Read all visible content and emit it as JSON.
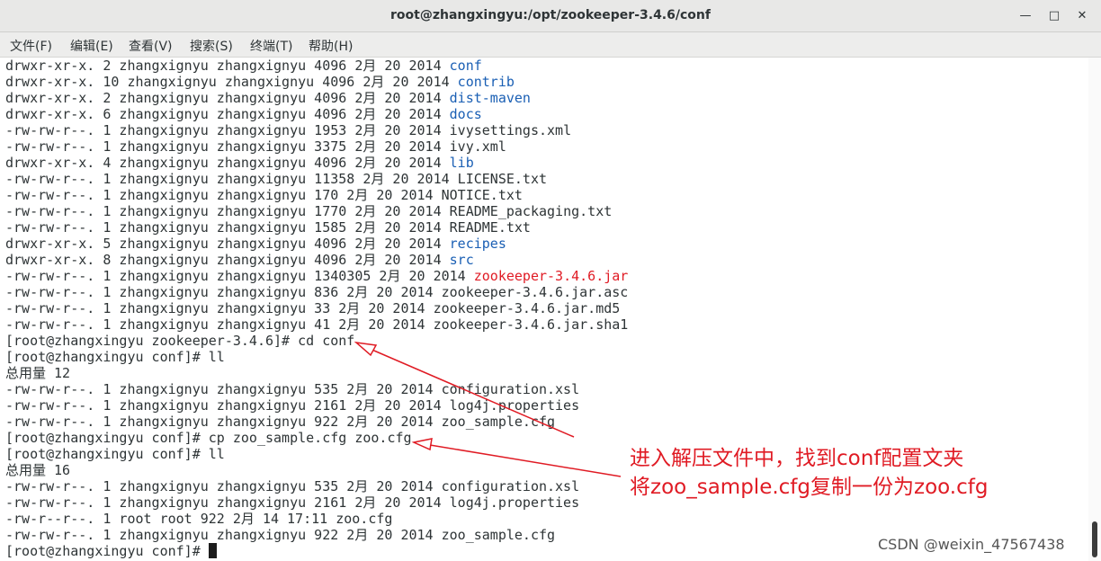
{
  "window": {
    "title": "root@zhangxingyu:/opt/zookeeper-3.4.6/conf",
    "minimize_icon": "minimize-icon",
    "maximize_icon": "maximize-icon",
    "close_icon": "close-icon"
  },
  "menu": [
    "文件(F)",
    "编辑(E)",
    "查看(V)",
    "搜索(S)",
    "终端(T)",
    "帮助(H)"
  ],
  "terminal": {
    "lines": [
      {
        "text": "drwxr-xr-x. 2 zhangxignyu zhangxignyu 4096 2月 20 2014 ",
        "name": "conf",
        "color": "blue"
      },
      {
        "text": "drwxr-xr-x. 10 zhangxignyu zhangxignyu 4096 2月 20 2014 ",
        "name": "contrib",
        "color": "blue"
      },
      {
        "text": "drwxr-xr-x. 2 zhangxignyu zhangxignyu 4096 2月 20 2014 ",
        "name": "dist-maven",
        "color": "blue"
      },
      {
        "text": "drwxr-xr-x. 6 zhangxignyu zhangxignyu 4096 2月 20 2014 ",
        "name": "docs",
        "color": "blue"
      },
      {
        "text": "-rw-rw-r--. 1 zhangxignyu zhangxignyu 1953 2月 20 2014 ",
        "name": "ivysettings.xml",
        "color": ""
      },
      {
        "text": "-rw-rw-r--. 1 zhangxignyu zhangxignyu 3375 2月 20 2014 ",
        "name": "ivy.xml",
        "color": ""
      },
      {
        "text": "drwxr-xr-x. 4 zhangxignyu zhangxignyu 4096 2月 20 2014 ",
        "name": "lib",
        "color": "blue"
      },
      {
        "text": "-rw-rw-r--. 1 zhangxignyu zhangxignyu 11358 2月 20 2014 ",
        "name": "LICENSE.txt",
        "color": ""
      },
      {
        "text": "-rw-rw-r--. 1 zhangxignyu zhangxignyu 170 2月 20 2014 ",
        "name": "NOTICE.txt",
        "color": ""
      },
      {
        "text": "-rw-rw-r--. 1 zhangxignyu zhangxignyu 1770 2月 20 2014 ",
        "name": "README_packaging.txt",
        "color": ""
      },
      {
        "text": "-rw-rw-r--. 1 zhangxignyu zhangxignyu 1585 2月 20 2014 ",
        "name": "README.txt",
        "color": ""
      },
      {
        "text": "drwxr-xr-x. 5 zhangxignyu zhangxignyu 4096 2月 20 2014 ",
        "name": "recipes",
        "color": "blue"
      },
      {
        "text": "drwxr-xr-x. 8 zhangxignyu zhangxignyu 4096 2月 20 2014 ",
        "name": "src",
        "color": "blue"
      },
      {
        "text": "-rw-rw-r--. 1 zhangxignyu zhangxignyu 1340305 2月 20 2014 ",
        "name": "zookeeper-3.4.6.jar",
        "color": "red"
      },
      {
        "text": "-rw-rw-r--. 1 zhangxignyu zhangxignyu 836 2月 20 2014 ",
        "name": "zookeeper-3.4.6.jar.asc",
        "color": ""
      },
      {
        "text": "-rw-rw-r--. 1 zhangxignyu zhangxignyu 33 2月 20 2014 ",
        "name": "zookeeper-3.4.6.jar.md5",
        "color": ""
      },
      {
        "text": "-rw-rw-r--. 1 zhangxignyu zhangxignyu 41 2月 20 2014 ",
        "name": "zookeeper-3.4.6.jar.sha1",
        "color": ""
      },
      {
        "text": "[root@zhangxingyu zookeeper-3.4.6]# cd conf",
        "name": "",
        "color": ""
      },
      {
        "text": "[root@zhangxingyu conf]# ll",
        "name": "",
        "color": ""
      },
      {
        "text": "总用量 12",
        "name": "",
        "color": ""
      },
      {
        "text": "-rw-rw-r--. 1 zhangxignyu zhangxignyu 535 2月 20 2014 configuration.xsl",
        "name": "",
        "color": ""
      },
      {
        "text": "-rw-rw-r--. 1 zhangxignyu zhangxignyu 2161 2月 20 2014 log4j.properties",
        "name": "",
        "color": ""
      },
      {
        "text": "-rw-rw-r--. 1 zhangxignyu zhangxignyu 922 2月 20 2014 zoo_sample.cfg",
        "name": "",
        "color": ""
      },
      {
        "text": "[root@zhangxingyu conf]# cp zoo_sample.cfg zoo.cfg",
        "name": "",
        "color": ""
      },
      {
        "text": "[root@zhangxingyu conf]# ll",
        "name": "",
        "color": ""
      },
      {
        "text": "总用量 16",
        "name": "",
        "color": ""
      },
      {
        "text": "-rw-rw-r--. 1 zhangxignyu zhangxignyu 535 2月 20 2014 configuration.xsl",
        "name": "",
        "color": ""
      },
      {
        "text": "-rw-rw-r--. 1 zhangxignyu zhangxignyu 2161 2月 20 2014 log4j.properties",
        "name": "",
        "color": ""
      },
      {
        "text": "-rw-r--r--. 1 root root 922 2月 14 17:11 zoo.cfg",
        "name": "",
        "color": ""
      },
      {
        "text": "-rw-rw-r--. 1 zhangxignyu zhangxignyu 922 2月 20 2014 zoo_sample.cfg",
        "name": "",
        "color": ""
      },
      {
        "text": "[root@zhangxingyu conf]# ",
        "name": "",
        "color": "",
        "cursor": true
      }
    ]
  },
  "annotation": {
    "line1": "进入解压文件中，找到conf配置文夹",
    "line2": "将zoo_sample.cfg复制一份为zoo.cfg",
    "color": "#e01b24"
  },
  "watermark": "CSDN @weixin_47567438"
}
